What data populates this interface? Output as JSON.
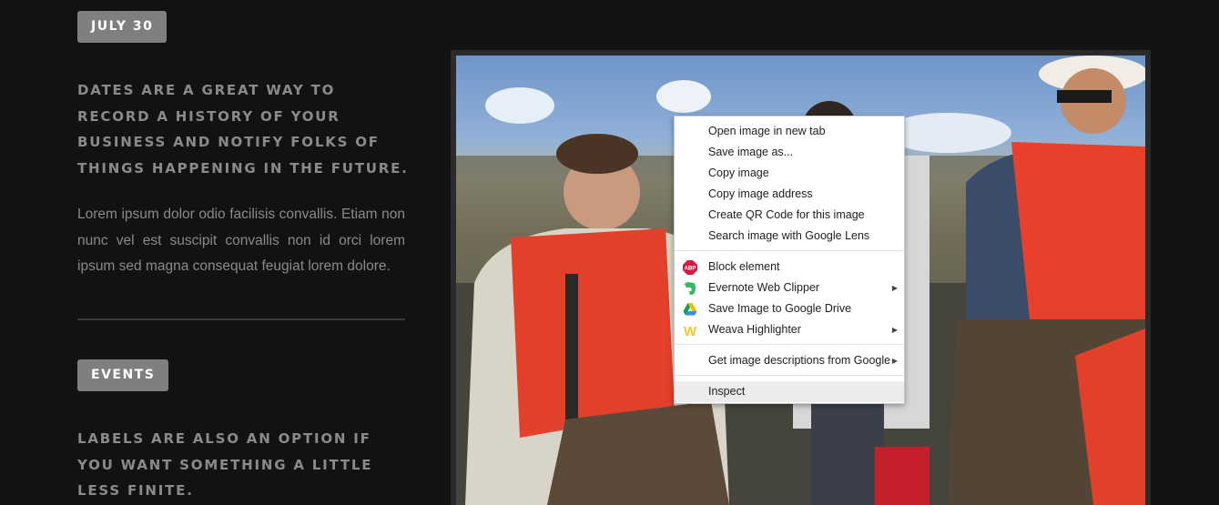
{
  "sections": [
    {
      "tag": "JULY 30",
      "heading": "Dates are a great way to record a history of your business and notify folks of things happening in the future.",
      "body": "Lorem ipsum dolor odio facilisis convallis. Etiam non nunc vel est suscipit convallis non id orci lorem ipsum sed magna consequat feugiat lorem dolore."
    },
    {
      "tag": "EVENTS",
      "heading": "Labels are also an option if you want something a little less finite."
    }
  ],
  "context_menu": {
    "items": [
      {
        "label": "Open image in new tab"
      },
      {
        "label": "Save image as..."
      },
      {
        "label": "Copy image"
      },
      {
        "label": "Copy image address"
      },
      {
        "label": "Create QR Code for this image"
      },
      {
        "label": "Search image with Google Lens"
      },
      {
        "label": "Block element",
        "icon": "adblock-plus-icon",
        "icon_text": "ABP"
      },
      {
        "label": "Evernote Web Clipper",
        "icon": "evernote-icon",
        "submenu": true
      },
      {
        "label": "Save Image to Google Drive",
        "icon": "google-drive-icon"
      },
      {
        "label": "Weava Highlighter",
        "icon": "weava-icon",
        "icon_text": "W",
        "submenu": true
      },
      {
        "label": "Get image descriptions from Google",
        "submenu": true
      },
      {
        "label": "Inspect",
        "hovered": true
      }
    ]
  },
  "colors": {
    "page_bg": "#121212",
    "tag_bg": "#7f7f7f",
    "text_muted": "#8a8a8a",
    "menu_hover": "#ececec",
    "abp_red": "#d8183c",
    "evernote_green": "#2dbe60",
    "weava_yellow": "#f7c52b"
  }
}
